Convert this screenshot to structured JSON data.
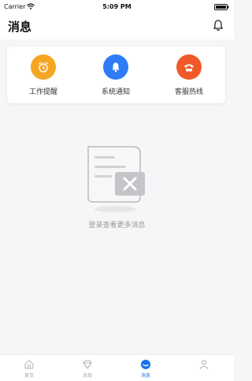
{
  "status_bar": {
    "carrier": "Carrier",
    "time": "5:09 PM"
  },
  "header": {
    "title": "消息",
    "bell_icon": "bell-icon"
  },
  "quick_actions": [
    {
      "label": "工作提醒",
      "icon": "alarm-clock-icon",
      "color": "#f5a623"
    },
    {
      "label": "系统通知",
      "icon": "bell-icon",
      "color": "#2f7cf6"
    },
    {
      "label": "客服热线",
      "icon": "phone-icon",
      "color": "#f05a28"
    }
  ],
  "empty_state": {
    "text": "登录查看更多消息",
    "icon": "empty-message-icon"
  },
  "tabs": [
    {
      "label": "首页",
      "icon": "home-icon",
      "active": false
    },
    {
      "label": "发现",
      "icon": "diamond-icon",
      "active": false
    },
    {
      "label": "消息",
      "icon": "message-icon",
      "active": true
    },
    {
      "label": "",
      "icon": "user-icon",
      "active": false
    }
  ],
  "colors": {
    "accent": "#1a73e8",
    "background": "#f6f6f8"
  }
}
